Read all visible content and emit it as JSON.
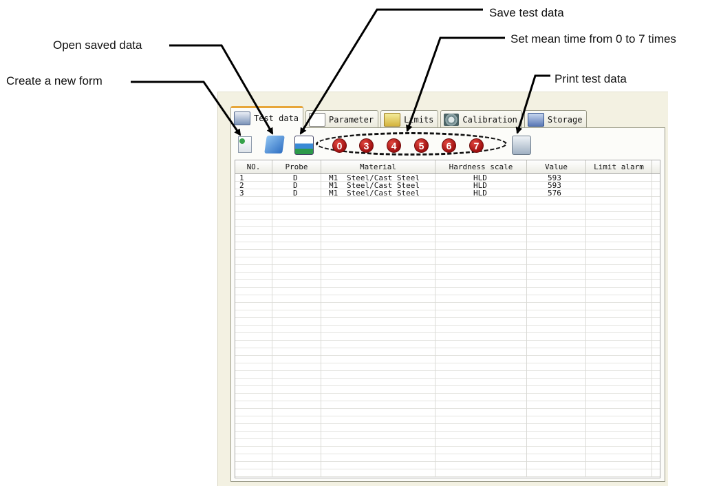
{
  "callouts": {
    "create": "Create a new form",
    "open": "Open saved data",
    "save": "Save test data",
    "mean": "Set mean time from 0 to 7 times",
    "print": "Print test data"
  },
  "tabs": [
    {
      "label": "Test data",
      "icon": "test-data-icon"
    },
    {
      "label": "Parameter",
      "icon": "parameter-icon"
    },
    {
      "label": "Limits",
      "icon": "limits-icon"
    },
    {
      "label": "Calibration",
      "icon": "calibration-icon"
    },
    {
      "label": "Storage",
      "icon": "storage-icon"
    }
  ],
  "mean_buttons": [
    "0",
    "3",
    "4",
    "5",
    "6",
    "7"
  ],
  "table": {
    "columns": [
      "NO.",
      "Probe",
      "Material",
      "Hardness scale",
      "Value",
      "Limit alarm"
    ],
    "rows": [
      {
        "no": "1",
        "probe": "D",
        "mat_code": "M1",
        "material": "Steel/Cast Steel",
        "scale": "HLD",
        "value": "593",
        "alarm": ""
      },
      {
        "no": "2",
        "probe": "D",
        "mat_code": "M1",
        "material": "Steel/Cast Steel",
        "scale": "HLD",
        "value": "593",
        "alarm": ""
      },
      {
        "no": "3",
        "probe": "D",
        "mat_code": "M1",
        "material": "Steel/Cast Steel",
        "scale": "HLD",
        "value": "576",
        "alarm": ""
      }
    ]
  },
  "colors": {
    "active_tab_accent": "#e7a63a",
    "mean_button": "#b3161a",
    "window_bg": "#f3f1e2"
  }
}
